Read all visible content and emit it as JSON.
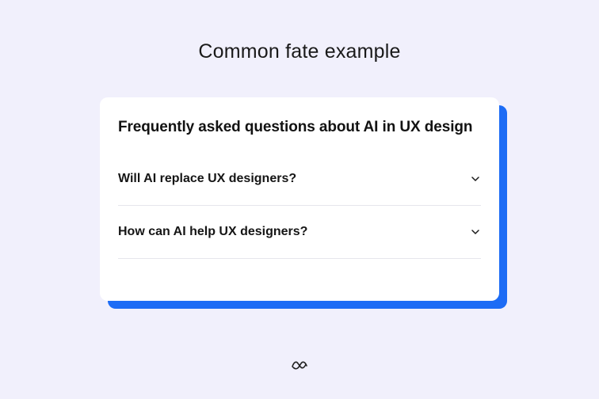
{
  "page": {
    "title": "Common fate example"
  },
  "faq": {
    "heading": "Frequently asked questions about AI in UX design",
    "items": [
      {
        "question": "Will AI replace UX designers?",
        "icon": "chevron-down-icon"
      },
      {
        "question": "How can AI help UX designers?",
        "icon": "chevron-down-icon"
      }
    ]
  },
  "logo": {
    "icon": "brand-logo-icon"
  },
  "colors": {
    "background": "#f1f0fc",
    "card": "#ffffff",
    "accent_shadow": "#1d6cf5",
    "text": "#121212",
    "divider": "#e6e6ec"
  }
}
